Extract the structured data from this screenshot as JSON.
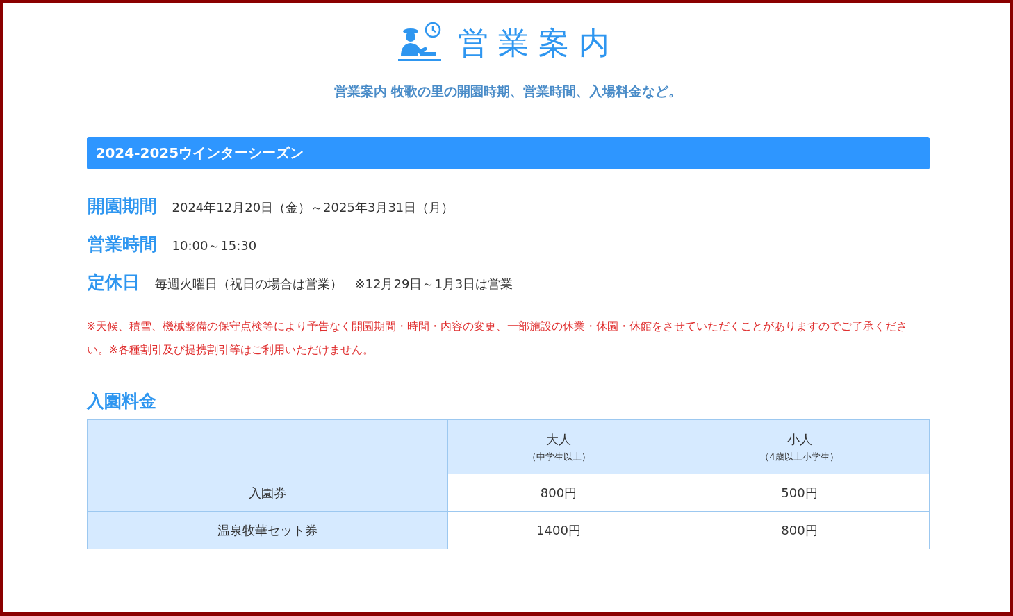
{
  "header": {
    "title": "営業案内",
    "subtitle": "営業案内 牧歌の里の開園時期、営業時間、入場料金など。"
  },
  "season": {
    "heading": "2024-2025ウインターシーズン"
  },
  "info": [
    {
      "label": "開園期間",
      "value": "2024年12月20日（金）～2025年3月31日（月）"
    },
    {
      "label": "営業時間",
      "value": "10:00～15:30"
    },
    {
      "label": "定休日",
      "value": "毎週火曜日（祝日の場合は営業）　※12月29日～1月3日は営業"
    }
  ],
  "notice": "※天候、積雪、機械整備の保守点検等により予告なく開園期間・時間・内容の変更、一部施設の休業・休園・休館をさせていただくことがありますのでご了承ください。※各種割引及び提携割引等はご利用いただけません。",
  "fees": {
    "heading": "入園料金",
    "columns": [
      {
        "name": "大人",
        "note": "（中学生以上）"
      },
      {
        "name": "小人",
        "note": "（4歳以上小学生）"
      }
    ],
    "rows": [
      {
        "label": "入園券",
        "values": [
          "800円",
          "500円"
        ]
      },
      {
        "label": "温泉牧華セット券",
        "values": [
          "1400円",
          "800円"
        ]
      }
    ]
  }
}
